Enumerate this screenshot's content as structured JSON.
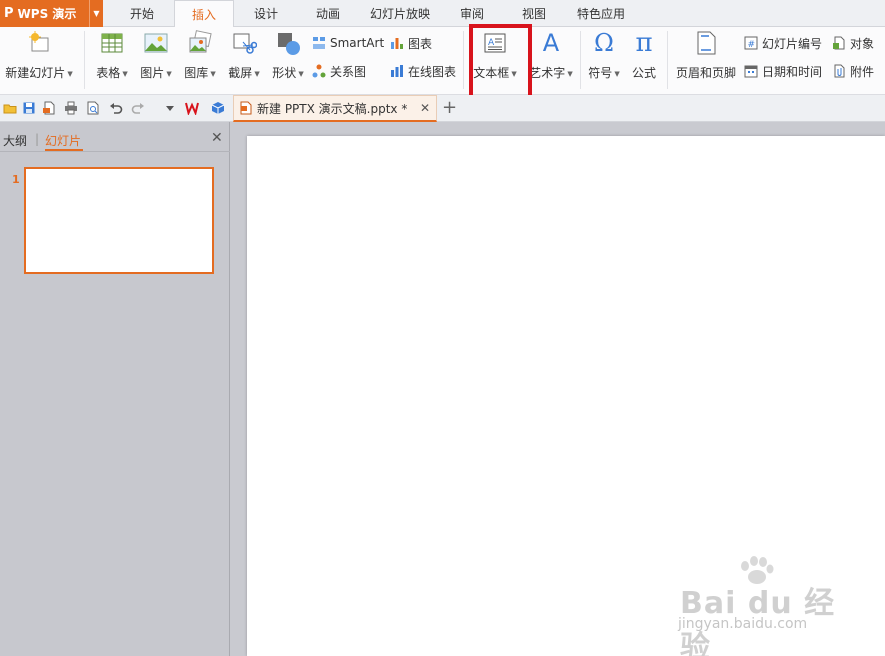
{
  "app": {
    "name": "WPS 演示",
    "logo": "P"
  },
  "menu_tabs": [
    "开始",
    "插入",
    "设计",
    "动画",
    "幻灯片放映",
    "审阅",
    "视图",
    "特色应用"
  ],
  "active_menu_tab": "插入",
  "ribbon": {
    "new_slide": "新建幻灯片",
    "table": "表格",
    "picture": "图片",
    "gallery": "图库",
    "screenshot": "截屏",
    "shape": "形状",
    "smartart": "SmartArt",
    "relation": "关系图",
    "chart": "图表",
    "online_chart": "在线图表",
    "textbox": "文本框",
    "wordart": "艺术字",
    "symbol": "符号",
    "formula": "公式",
    "header_footer": "页眉和页脚",
    "slide_number": "幻灯片编号",
    "date_time": "日期和时间",
    "object": "对象",
    "attachment": "附件",
    "formula_glyph": "π",
    "symbol_glyph": "Ω",
    "wordart_glyph": "A"
  },
  "document_tab": {
    "title": "新建 PPTX 演示文稿.pptx *"
  },
  "left_panel": {
    "outline_tab": "大纲",
    "slides_tab": "幻灯片",
    "slides": [
      {
        "number": "1"
      }
    ]
  },
  "watermark": {
    "main": "Bai du 经验",
    "url": "jingyan.baidu.com"
  },
  "colors": {
    "accent": "#e46c21",
    "highlight": "#d8131c"
  }
}
